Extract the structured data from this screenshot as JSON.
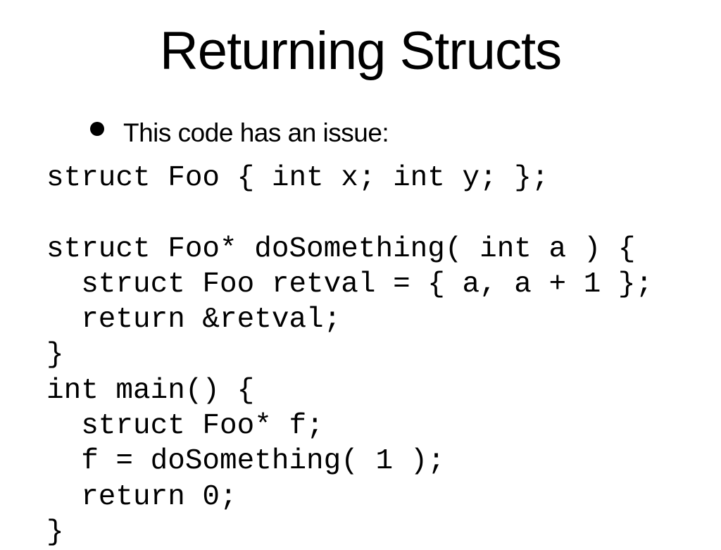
{
  "slide": {
    "title": "Returning Structs",
    "bullet": "This code has an issue:",
    "code_lines": [
      "struct Foo { int x; int y; };",
      "",
      "struct Foo* doSomething( int a ) {",
      "  struct Foo retval = { a, a + 1 };",
      "  return &retval;",
      "}",
      "int main() {",
      "  struct Foo* f;",
      "  f = doSomething( 1 );",
      "  return 0;",
      "}"
    ]
  }
}
